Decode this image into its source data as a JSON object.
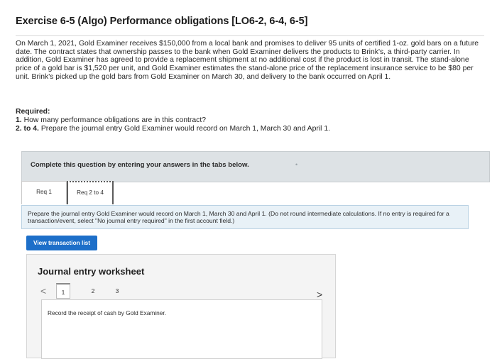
{
  "header": {
    "title": "Exercise 6-5 (Algo) Performance obligations [LO6-2, 6-4, 6-5]"
  },
  "intro": {
    "paragraph": "On March 1, 2021, Gold Examiner receives $150,000 from a local bank and promises to deliver 95 units of certified 1-oz. gold bars on a future date. The contract states that ownership passes to the bank when Gold Examiner delivers the products to Brink's, a third-party carrier. In addition, Gold Examiner has agreed to provide a replacement shipment at no additional cost if the product is lost in transit. The stand-alone price of a gold bar is $1,520 per unit, and Gold Examiner estimates the stand-alone price of the replacement insurance service to be $80 per unit. Brink's picked up the gold bars from Gold Examiner on March 30, and delivery to the bank occurred on April 1."
  },
  "required": {
    "heading": "Required:",
    "items": [
      {
        "num": "1.",
        "text": "How many performance obligations are in this contract?"
      },
      {
        "num": "2. to 4.",
        "text": "Prepare the journal entry Gold Examiner would record on March 1, March 30 and April 1."
      }
    ]
  },
  "banner": {
    "text": "Complete this question by entering your answers in the tabs below."
  },
  "tabs": [
    {
      "label": "Req 1"
    },
    {
      "label": "Req 2 to 4"
    }
  ],
  "instructions": {
    "text": "Prepare the journal entry Gold Examiner would record on March 1, March 30 and April 1. (Do not round intermediate calculations. If no entry is required for a transaction/event, select \"No journal entry required\" in the first account field.)"
  },
  "view_button": {
    "label": "View transaction list"
  },
  "worksheet": {
    "title": "Journal entry worksheet",
    "pages": [
      "1",
      "2",
      "3"
    ],
    "prev_icon": "<",
    "next_icon": ">",
    "record_text": "Record the receipt of cash by Gold Examiner."
  }
}
